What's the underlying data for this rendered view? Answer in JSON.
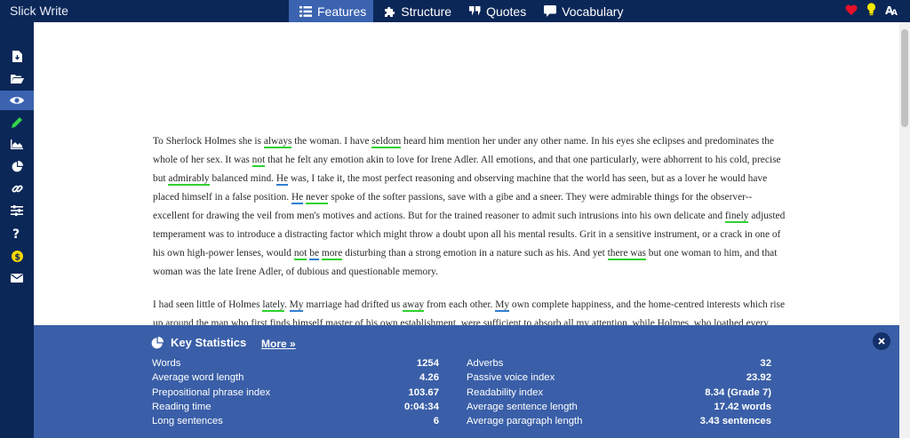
{
  "app": {
    "title": "Slick Write"
  },
  "nav": [
    {
      "label": "Features",
      "icon": "list-icon",
      "active": true
    },
    {
      "label": "Structure",
      "icon": "puzzle-icon",
      "active": false
    },
    {
      "label": "Quotes",
      "icon": "quote-icon",
      "active": false
    },
    {
      "label": "Vocabulary",
      "icon": "comment-icon",
      "active": false
    }
  ],
  "top_icons": [
    "heart-icon",
    "lightbulb-icon",
    "font-icon"
  ],
  "sidebar": [
    "file-download-icon",
    "folder-open-icon",
    "eye-icon",
    "pencil-icon",
    "area-chart-icon",
    "pie-chart-icon",
    "link-icon",
    "sliders-icon",
    "question-icon",
    "dollar-icon",
    "envelope-icon"
  ],
  "document": {
    "paragraphs": [
      [
        {
          "t": "To Sherlock Holmes she is "
        },
        {
          "t": "always",
          "h": "g"
        },
        {
          "t": " the woman. I have "
        },
        {
          "t": "seldom",
          "h": "g"
        },
        {
          "t": " heard him mention her under any other name. In his eyes she eclipses and predominates the whole of her sex. It was "
        },
        {
          "t": "not",
          "h": "g"
        },
        {
          "t": " that he felt any emotion akin to love for Irene Adler. All emotions, and that one particularly, were abhorrent to his cold, precise but "
        },
        {
          "t": "admirably",
          "h": "g"
        },
        {
          "t": " balanced mind. "
        },
        {
          "t": "He",
          "h": "b"
        },
        {
          "t": " was, I take it, the most perfect reasoning and observing machine that the world has seen, but as a lover he would have placed himself in a false position. "
        },
        {
          "t": "He",
          "h": "b"
        },
        {
          "t": " "
        },
        {
          "t": "never",
          "h": "g"
        },
        {
          "t": " spoke of the softer passions, save with a gibe and a sneer. They were admirable things for the observer--excellent for drawing the veil from men's motives and actions. But for the trained reasoner to admit such intrusions into his own delicate and "
        },
        {
          "t": "finely",
          "h": "g"
        },
        {
          "t": " adjusted temperament was to introduce a distracting factor which might throw a doubt upon all his mental results. Grit in a sensitive instrument, or a crack in one of his own high-power lenses, would "
        },
        {
          "t": "not",
          "h": "g"
        },
        {
          "t": " "
        },
        {
          "t": "be",
          "h": "b"
        },
        {
          "t": " "
        },
        {
          "t": "more",
          "h": "g"
        },
        {
          "t": " disturbing than a strong emotion in a nature such as his. And yet "
        },
        {
          "t": "there was",
          "h": "g"
        },
        {
          "t": " but one woman to him, and that woman was the late Irene Adler, of dubious and questionable memory."
        }
      ],
      [
        {
          "t": "I had seen little of Holmes "
        },
        {
          "t": "lately",
          "h": "g"
        },
        {
          "t": ". "
        },
        {
          "t": "My",
          "h": "b"
        },
        {
          "t": " marriage had drifted us "
        },
        {
          "t": "away",
          "h": "g"
        },
        {
          "t": " from each other. "
        },
        {
          "t": "My",
          "h": "b"
        },
        {
          "t": " own complete happiness, and the home-centred interests which rise up around the man who first finds himself master of his own establishment, were sufficient to absorb all my attention, while Holmes, who loathed every form of society with his whole Bohemian soul, remained in our lodgings in Baker Street."
        }
      ]
    ]
  },
  "stats": {
    "title": "Key Statistics",
    "more_label": "More »",
    "left": [
      {
        "label": "Words",
        "value": "1254"
      },
      {
        "label": "Average word length",
        "value": "4.26"
      },
      {
        "label": "Prepositional phrase index",
        "value": "103.67"
      },
      {
        "label": "Reading time",
        "value": "0:04:34"
      },
      {
        "label": "Long sentences",
        "value": "6"
      }
    ],
    "right": [
      {
        "label": "Adverbs",
        "value": "32"
      },
      {
        "label": "Passive voice index",
        "value": "23.92"
      },
      {
        "label": "Readability index",
        "value": "8.34 (Grade 7)"
      },
      {
        "label": "Average sentence length",
        "value": "17.42 words"
      },
      {
        "label": "Average paragraph length",
        "value": "3.43 sentences"
      }
    ]
  },
  "colors": {
    "topbar": "#0b2757",
    "active": "#3b63b0",
    "stats_panel": "#3a5fa8",
    "highlight_green": "#2fd12f",
    "highlight_blue": "#2f7fd1"
  }
}
